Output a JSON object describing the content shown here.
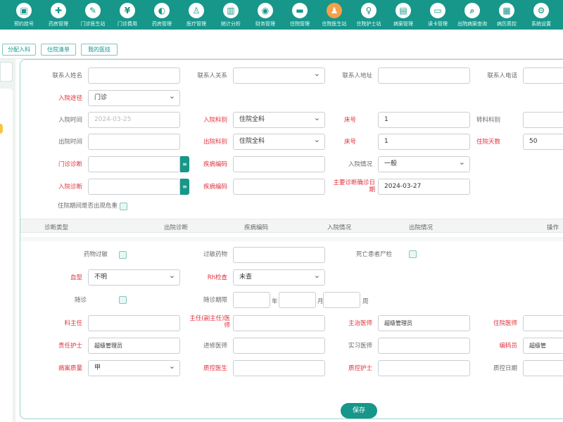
{
  "nav": [
    {
      "label": "预约挂号",
      "icon": "calendar-icon",
      "glyph": "▣"
    },
    {
      "label": "药房管理",
      "icon": "pharmacy-icon",
      "glyph": "✚"
    },
    {
      "label": "门诊医生站",
      "icon": "doctor-icon",
      "glyph": "✎"
    },
    {
      "label": "门诊费用",
      "icon": "coin-icon",
      "glyph": "¥"
    },
    {
      "label": "药房管理",
      "icon": "pill-icon",
      "glyph": "◐"
    },
    {
      "label": "医疗管理",
      "icon": "user-icon",
      "glyph": "♙"
    },
    {
      "label": "统计分析",
      "icon": "chart-icon",
      "glyph": "▥"
    },
    {
      "label": "财务管理",
      "icon": "money-icon",
      "glyph": "◉"
    },
    {
      "label": "住院管理",
      "icon": "bed-icon",
      "glyph": "▬"
    },
    {
      "label": "住院医生站",
      "icon": "inpatient-doctor-icon",
      "glyph": "♟",
      "active": true
    },
    {
      "label": "住院护士站",
      "icon": "nurse-icon",
      "glyph": "♀"
    },
    {
      "label": "病案管理",
      "icon": "record-icon",
      "glyph": "▤"
    },
    {
      "label": "读卡管理",
      "icon": "card-icon",
      "glyph": "▭"
    },
    {
      "label": "出院病案查询",
      "icon": "search-record-icon",
      "glyph": "⌕"
    },
    {
      "label": "病历质控",
      "icon": "clipboard-icon",
      "glyph": "▦"
    },
    {
      "label": "系统设置",
      "icon": "settings-icon",
      "glyph": "⚙"
    }
  ],
  "tabs": [
    "分配入科",
    "住院清单",
    "我的医技"
  ],
  "form": {
    "contact_name_label": "联系人姓名",
    "contact_relation_label": "联系人关系",
    "contact_address_label": "联系人地址",
    "contact_phone_label": "联系人电话",
    "admission_route_label": "入院途径",
    "admission_route_value": "门诊",
    "admission_time_label": "入院时间",
    "admission_time_value": "2024-03-25",
    "admission_dept_label": "入院科别",
    "admission_dept_value": "住院全科",
    "bed_label": "床号",
    "bed_value": "1",
    "transfer_dept_label": "转科科别",
    "discharge_time_label": "出院时间",
    "discharge_dept_label": "出院科别",
    "discharge_dept_value": "住院全科",
    "bed2_label": "床号",
    "bed2_value": "1",
    "stay_days_label": "住院天数",
    "stay_days_value": "50",
    "outpatient_diag_label": "门诊诊断",
    "disease_code_label": "疾病编码",
    "admission_condition_label": "入院情况",
    "admission_condition_value": "一般",
    "admission_diag_label": "入院诊断",
    "disease_code2_label": "疾病编码",
    "main_diag_date_label": "主要诊断确诊日期",
    "main_diag_date_value": "2024-03-27",
    "critical_label": "住院期间是否出现危重"
  },
  "table_headers": [
    "诊断类型",
    "出院诊断",
    "疾病编码",
    "入院情况",
    "出院情况",
    "操作"
  ],
  "form2": {
    "drug_allergy_label": "药物过敏",
    "allergy_drug_label": "过敏药物",
    "autopsy_label": "死亡患者尸检",
    "blood_type_label": "血型",
    "blood_type_value": "不明",
    "rh_label": "Rh检查",
    "rh_value": "未查",
    "followup_label": "随诊",
    "followup_period_label": "随诊期限",
    "unit_year": "年",
    "unit_month": "月",
    "unit_week": "周",
    "dept_director_label": "科主任",
    "chief_physician_label": "主任(副主任)医师",
    "attending_label": "主治医师",
    "attending_value": "超级管理员",
    "resident_label": "住院医师",
    "nurse_label": "责任护士",
    "nurse_value": "超级管理员",
    "advanced_doctor_label": "进修医师",
    "intern_label": "实习医师",
    "coder_label": "编码员",
    "coder_value": "超级管",
    "quality_label": "病案质量",
    "quality_value": "甲",
    "qc_doctor_label": "质控医生",
    "qc_nurse_label": "质控护士",
    "qc_date_label": "质控日期"
  },
  "save_label": "保存",
  "colors": {
    "primary": "#17968a",
    "required": "#e0303c"
  }
}
